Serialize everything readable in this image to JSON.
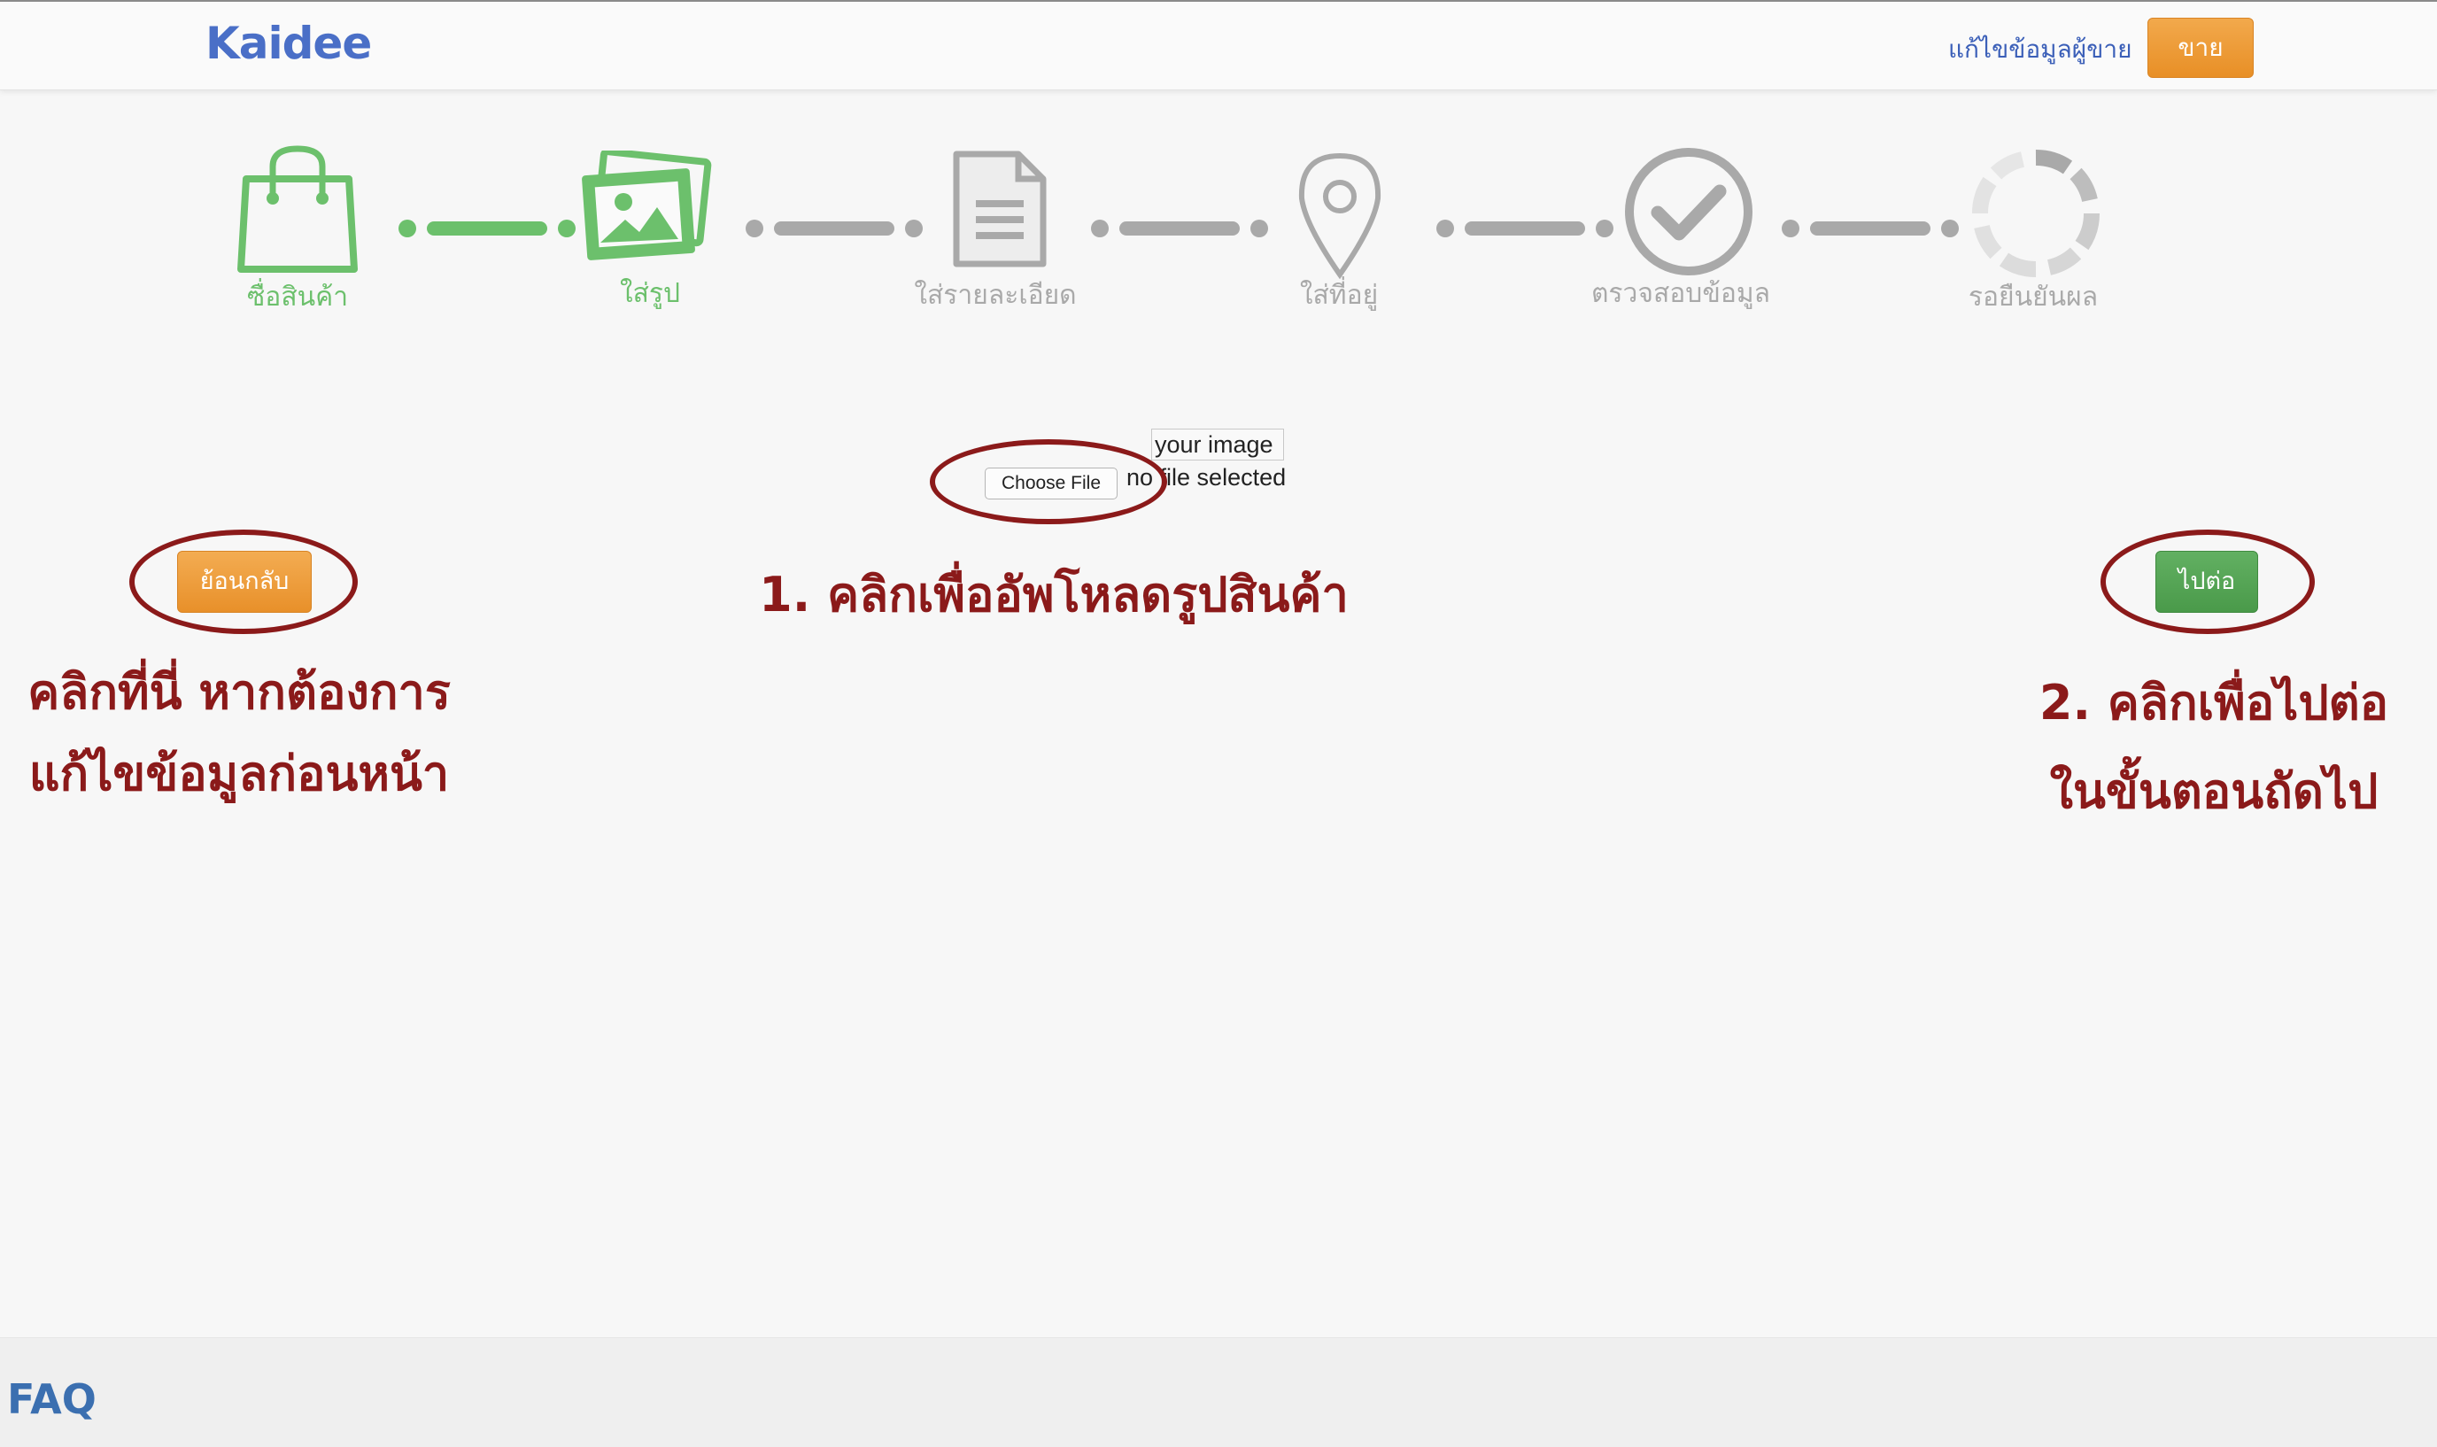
{
  "header": {
    "logo": "Kaidee",
    "edit_seller_link": "แก้ไขข้อมูลผู้ขาย",
    "sell_button": "ขาย"
  },
  "steps": [
    {
      "label": "ซื่อสินค้า",
      "icon": "shopping-bag-icon",
      "state": "done"
    },
    {
      "label": "ใส่รูป",
      "icon": "photos-icon",
      "state": "current"
    },
    {
      "label": "ใส่รายละเอียด",
      "icon": "document-icon",
      "state": "pending"
    },
    {
      "label": "ใส่ที่อยู่",
      "icon": "location-pin-icon",
      "state": "pending"
    },
    {
      "label": "ตรวจสอบข้อมูล",
      "icon": "checkmark-circle-icon",
      "state": "pending"
    },
    {
      "label": "รอยืนยันผล",
      "icon": "loading-spinner-icon",
      "state": "pending"
    }
  ],
  "upload": {
    "image_alt": "your image",
    "choose_file_button": "Choose File",
    "file_status": "no file selected"
  },
  "buttons": {
    "back": "ย้อนกลับ",
    "next": "ไปต่อ"
  },
  "annotations": {
    "upload_hint": "1. คลิกเพื่ออัพโหลดรูปสินค้า",
    "back_hint_line1": "คลิกที่นี่  หากต้องการ",
    "back_hint_line2": "แก้ไขข้อมูลก่อนหน้า",
    "next_hint_line1": "2.  คลิกเพื่อไปต่อ",
    "next_hint_line2": "ในขั้นตอนถัดไป"
  },
  "footer": {
    "faq": "FAQ"
  },
  "colors": {
    "brand_blue": "#4a6fc7",
    "orange_button": "#ef9d3a",
    "green_button": "#55a555",
    "active_step": "#6cc06c",
    "inactive_step": "#a9a9a9",
    "annotation": "#8b1a1a"
  }
}
